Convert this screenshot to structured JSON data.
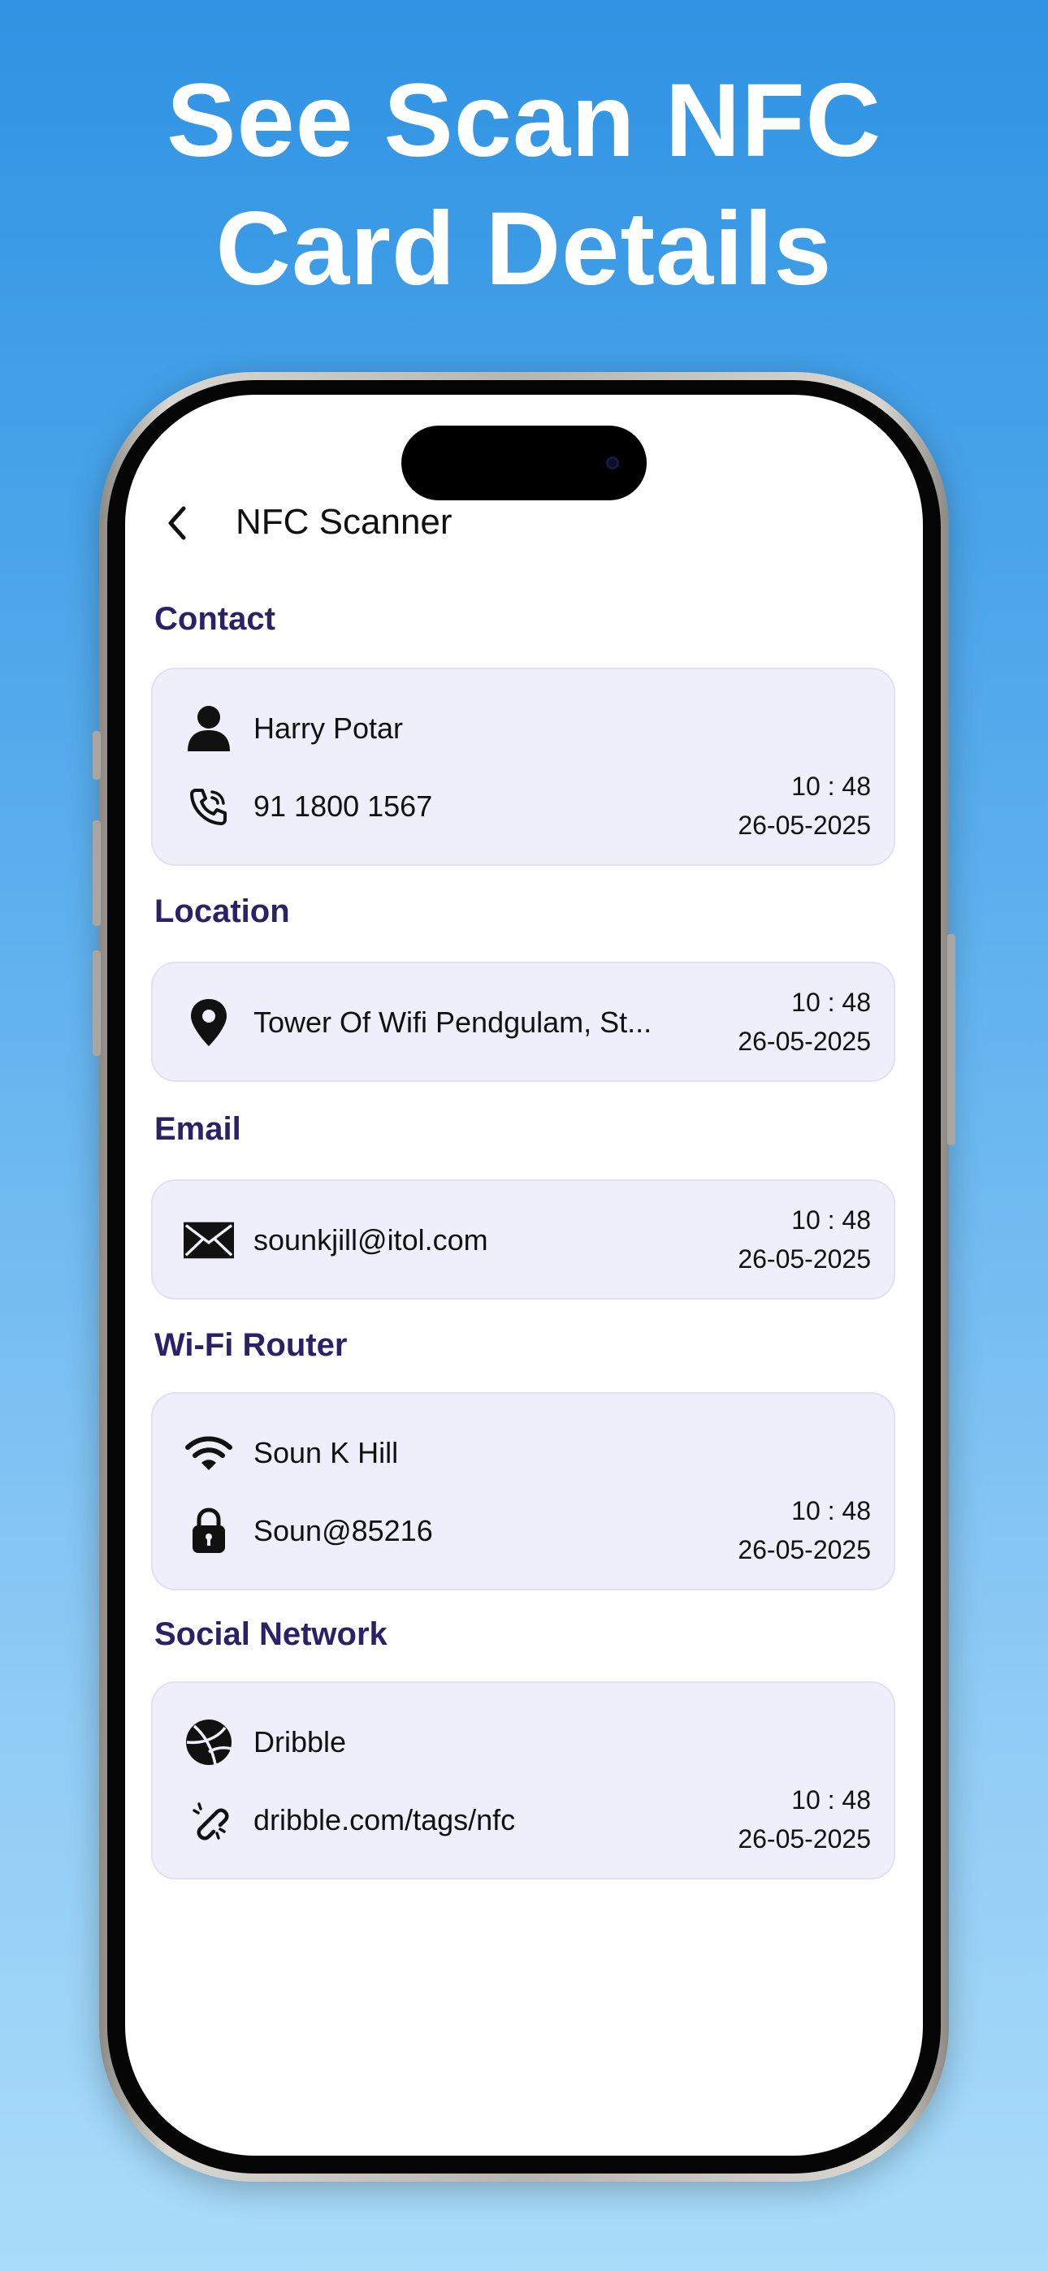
{
  "headline": {
    "line1": "See Scan NFC",
    "line2": "Card Details"
  },
  "app": {
    "title": "NFC Scanner"
  },
  "sections": {
    "contact": {
      "title": "Contact",
      "name": "Harry Potar",
      "phone": "91 1800 1567",
      "time": "10 : 48",
      "date": "26-05-2025"
    },
    "location": {
      "title": "Location",
      "address": "Tower Of Wifi Pendgulam, St...",
      "time": "10 : 48",
      "date": "26-05-2025"
    },
    "email": {
      "title": "Email",
      "address": "sounkjill@itol.com",
      "time": "10 : 48",
      "date": "26-05-2025"
    },
    "wifi": {
      "title": "Wi-Fi Router",
      "ssid": "Soun K Hill",
      "password": "Soun@85216",
      "time": "10 : 48",
      "date": "26-05-2025"
    },
    "social": {
      "title": "Social Network",
      "network": "Dribble",
      "link": "dribble.com/tags/nfc",
      "time": "10 : 48",
      "date": "26-05-2025"
    }
  },
  "icons": {
    "back": "chevron-left-icon",
    "person": "person-icon",
    "phone": "phone-icon",
    "location": "location-pin-icon",
    "email": "envelope-icon",
    "wifi": "wifi-icon",
    "lock": "lock-icon",
    "dribbble": "dribbble-icon",
    "link": "link-icon"
  },
  "colors": {
    "background_top": "#2f93e3",
    "background_bottom": "#a9dcf9",
    "section_title": "#2a2266",
    "card_bg": "#efeffb"
  }
}
